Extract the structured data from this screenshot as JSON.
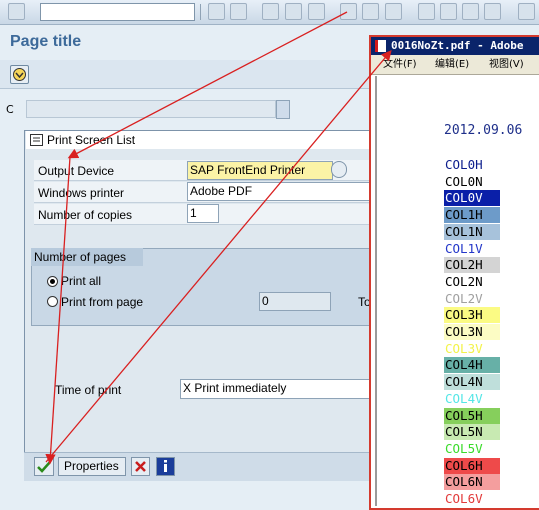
{
  "toolbar": {
    "icons": [
      "checkmark-icon",
      "back-icon",
      "save-icon",
      "nav-back-icon",
      "exit-icon",
      "cancel-icon",
      "print-icon",
      "find-icon",
      "find-next-icon",
      "first-page-icon",
      "prev-page-icon",
      "next-page-icon",
      "last-page-icon",
      "layout-icon"
    ]
  },
  "page": {
    "title": "Page title",
    "c_label": "C"
  },
  "dialog": {
    "title": "Print Screen List",
    "output_device_label": "Output Device",
    "output_device_value": "SAP FrontEnd Printer",
    "windows_printer_label": "Windows printer",
    "windows_printer_value": "Adobe PDF",
    "copies_label": "Number of copies",
    "copies_value": "1",
    "pages_group_label": "Number of pages",
    "print_all_label": "Print all",
    "print_from_label": "Print from page",
    "print_from_value": "0",
    "to_label": "To",
    "time_label": "Time of print",
    "time_value": "X Print immediately",
    "properties_label": "Properties"
  },
  "pdf": {
    "title": "0016NoZt.pdf - Adobe",
    "menu": [
      "文件(F)",
      "编辑(E)",
      "视图(V)"
    ],
    "date": "2012.09.06",
    "colors": [
      {
        "label": "COL0H",
        "bg": "#ffffff",
        "fg": "#0b1c8c"
      },
      {
        "label": "COL0N",
        "bg": "#ffffff",
        "fg": "#000000"
      },
      {
        "label": "COL0V",
        "bg": "#0a1fa8",
        "fg": "#ffffff"
      },
      {
        "label": "COL1H",
        "bg": "#6d9bc9",
        "fg": "#000000"
      },
      {
        "label": "COL1N",
        "bg": "#a7c2db",
        "fg": "#000000"
      },
      {
        "label": "COL1V",
        "bg": "#ffffff",
        "fg": "#2336c9"
      },
      {
        "label": "COL2H",
        "bg": "#d4d4d4",
        "fg": "#000000"
      },
      {
        "label": "COL2N",
        "bg": "#ffffff",
        "fg": "#000000"
      },
      {
        "label": "COL2V",
        "bg": "#ffffff",
        "fg": "#a0a0a0"
      },
      {
        "label": "COL3H",
        "bg": "#fbfb84",
        "fg": "#000000"
      },
      {
        "label": "COL3N",
        "bg": "#fcfcc4",
        "fg": "#000000"
      },
      {
        "label": "COL3V",
        "bg": "#ffffff",
        "fg": "#f3f34a"
      },
      {
        "label": "COL4H",
        "bg": "#67b0a7",
        "fg": "#000000"
      },
      {
        "label": "COL4N",
        "bg": "#bfdfdb",
        "fg": "#000000"
      },
      {
        "label": "COL4V",
        "bg": "#ffffff",
        "fg": "#54e6e6"
      },
      {
        "label": "COL5H",
        "bg": "#86cf5c",
        "fg": "#000000"
      },
      {
        "label": "COL5N",
        "bg": "#c8eab2",
        "fg": "#000000"
      },
      {
        "label": "COL5V",
        "bg": "#ffffff",
        "fg": "#3adb2a"
      },
      {
        "label": "COL6H",
        "bg": "#ee4a4a",
        "fg": "#000000"
      },
      {
        "label": "COL6N",
        "bg": "#f49e9e",
        "fg": "#000000"
      },
      {
        "label": "COL6V",
        "bg": "#ffffff",
        "fg": "#e23a3a"
      }
    ]
  },
  "accent": {
    "arrow": "#d92020",
    "title": "#3d6a9a"
  }
}
